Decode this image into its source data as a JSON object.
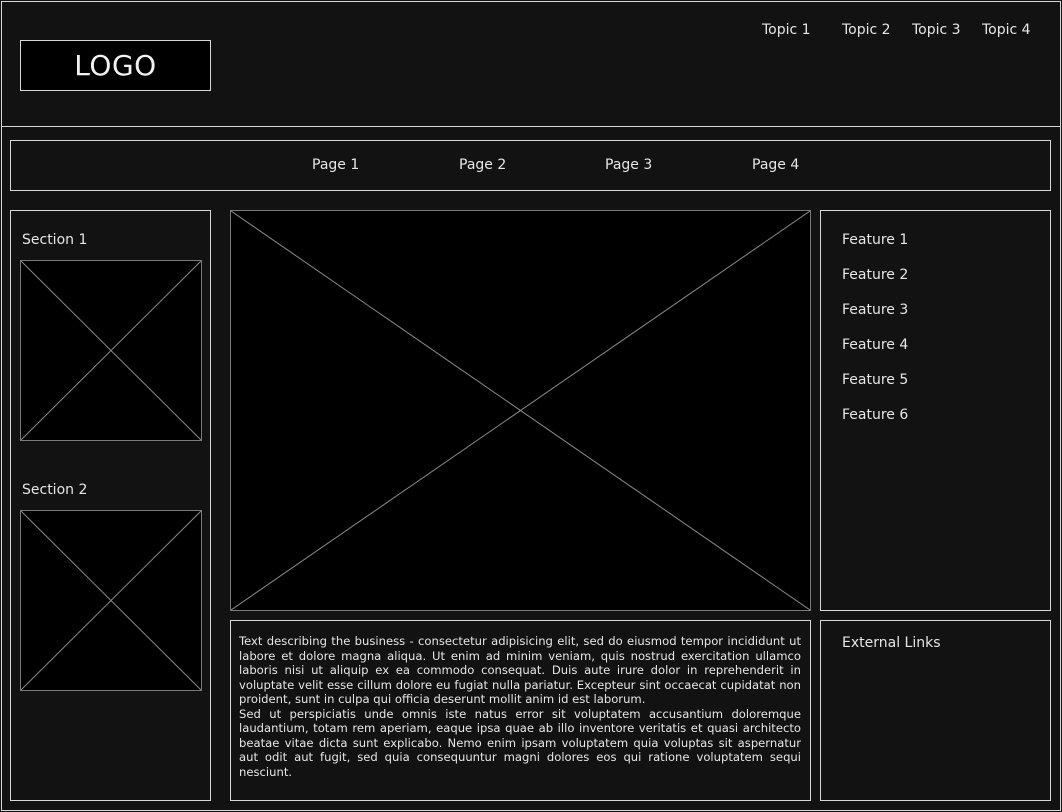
{
  "header": {
    "logo": "LOGO",
    "topics": [
      "Topic 1",
      "Topic 2",
      "Topic 3",
      "Topic 4"
    ]
  },
  "nav": {
    "pages": [
      "Page 1",
      "Page 2",
      "Page 3",
      "Page 4"
    ]
  },
  "sidebar": {
    "sections": [
      {
        "title": "Section 1"
      },
      {
        "title": "Section 2"
      }
    ]
  },
  "features": [
    "Feature 1",
    "Feature 2",
    "Feature 3",
    "Feature 4",
    "Feature 5",
    "Feature 6"
  ],
  "external_links": {
    "title": "External Links"
  },
  "body_text": {
    "paragraph1": "Text describing the business - consectetur adipisicing elit, sed do eiusmod tempor incididunt ut labore et dolore magna aliqua. Ut enim ad minim veniam, quis nostrud exercitation ullamco laboris nisi ut aliquip ex ea commodo consequat. Duis aute irure dolor in reprehenderit in voluptate velit esse cillum dolore eu fugiat nulla pariatur. Excepteur sint occaecat cupidatat non proident, sunt in culpa qui officia deserunt mollit anim id est laborum.",
    "paragraph2": "Sed ut perspiciatis unde omnis iste natus error sit voluptatem accusantium doloremque laudantium, totam rem aperiam, eaque ipsa quae ab illo inventore veritatis et quasi architecto beatae vitae dicta sunt explicabo. Nemo enim ipsam voluptatem quia voluptas sit aspernatur aut odit aut fugit, sed quia consequuntur magni dolores eos qui ratione voluptatem sequi nesciunt."
  },
  "colors": {
    "background": "#121212",
    "placeholder": "#000000",
    "stroke": "#d8d8d8",
    "text": "#e6e6e6"
  }
}
